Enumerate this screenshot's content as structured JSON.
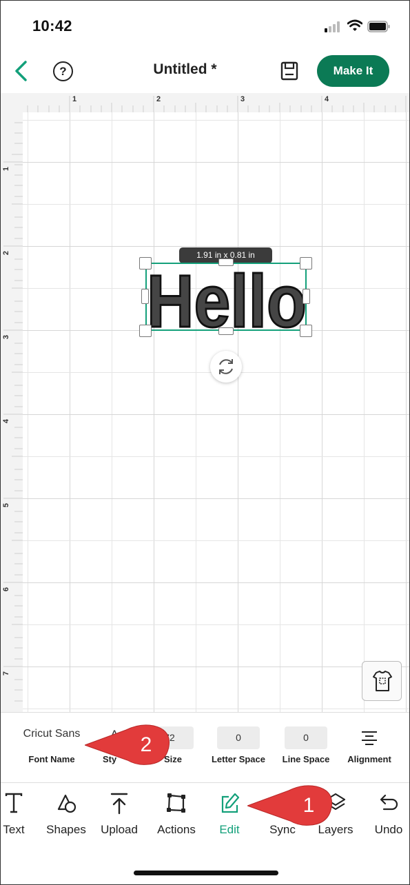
{
  "status_bar": {
    "time": "10:42"
  },
  "header": {
    "title": "Untitled  *",
    "make_it_label": "Make It"
  },
  "canvas": {
    "ruler_top_numbers": [
      "1",
      "2",
      "3",
      "4"
    ],
    "ruler_left_numbers": [
      "1",
      "2",
      "3",
      "4",
      "5",
      "6",
      "7"
    ],
    "selection_dimensions": "1.91 in x 0.81 in",
    "text_object": "Hello"
  },
  "text_properties": {
    "font_name_value": "Cricut Sans",
    "font_name_label": "Font Name",
    "style_glyph": "A",
    "style_label": "Sty",
    "size_value": "72",
    "size_label": "Size",
    "letter_space_value": "0",
    "letter_space_label": "Letter Space",
    "line_space_value": "0",
    "line_space_label": "Line Space",
    "alignment_label": "Alignment"
  },
  "toolbar": {
    "items": [
      {
        "label": "Text",
        "icon": "text-icon"
      },
      {
        "label": "Shapes",
        "icon": "shapes-icon"
      },
      {
        "label": "Upload",
        "icon": "upload-icon"
      },
      {
        "label": "Actions",
        "icon": "actions-icon"
      },
      {
        "label": "Edit",
        "icon": "edit-icon",
        "active": true
      },
      {
        "label": "Sync",
        "icon": "sync-icon"
      },
      {
        "label": "Layers",
        "icon": "layers-icon"
      },
      {
        "label": "Undo",
        "icon": "undo-icon"
      }
    ]
  },
  "callouts": [
    {
      "number": "1",
      "target": "Edit"
    },
    {
      "number": "2",
      "target": "Font Name"
    }
  ],
  "colors": {
    "accent": "#13a07a",
    "make_it_button": "#0b7a55",
    "callout": "#e23b3b"
  }
}
